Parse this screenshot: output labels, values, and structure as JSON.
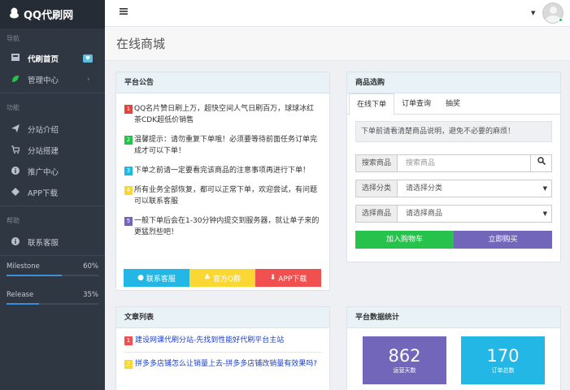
{
  "app": {
    "brand": "QQ代刷网"
  },
  "sidebar": {
    "section_nav": "导航",
    "home": "代刷首页",
    "home_badge": "♥",
    "admin": "管理中心",
    "section_func": "功能",
    "func": [
      "分站介绍",
      "分站搭建",
      "推广中心",
      "APP下载"
    ],
    "section_help": "帮助",
    "service": "联系客服",
    "progress": [
      {
        "label": "Milestone",
        "value": "60%",
        "fraction": 0.6
      },
      {
        "label": "Release",
        "value": "35%",
        "fraction": 0.35
      }
    ]
  },
  "page": {
    "title": "在线商城"
  },
  "notice": {
    "title": "平台公告",
    "items": [
      {
        "num": "1",
        "text": "QQ名片赞日刷上万，超快空间人气日刷百万，球球冰红茶CDK超低价销售",
        "color": "#e0463f"
      },
      {
        "num": "2",
        "text": "温馨提示：请勿重复下单哦！必须要等待前面任务订单完成才可以下单！",
        "color": "#27c24c"
      },
      {
        "num": "3",
        "text": "下单之前请一定要看完该商品的注意事项再进行下单！",
        "color": "#23b7e5"
      },
      {
        "num": "4",
        "text": "所有业务全部恢复，都可以正常下单，欢迎尝试，有问题可以联系客服",
        "color": "#fad733"
      },
      {
        "num": "5",
        "text": "一般下单后会在1-30分钟内提交到服务器，就让单子来的更猛烈些吧！",
        "color": "#7266ba"
      }
    ],
    "buttons": [
      {
        "label": "联系客服",
        "icon": "qq-icon",
        "color": "#23b7e5"
      },
      {
        "label": "官方Q群",
        "icon": "group-icon",
        "color": "#fad733"
      },
      {
        "label": "APP下载",
        "icon": "download-icon",
        "color": "#f05050"
      }
    ]
  },
  "shop": {
    "title": "商品选购",
    "tabs": [
      "在线下单",
      "订单查询",
      "抽奖"
    ],
    "tip": "下单前请看清楚商品说明，避免不必要的麻烦！",
    "search_label": "搜索商品",
    "search_placeholder": "搜索商品",
    "category_label": "选择分类",
    "category_value": "请选择分类",
    "product_label": "选择商品",
    "product_value": "请选择商品",
    "add_cart": "加入购物车",
    "buy_now": "立即购买"
  },
  "articles": {
    "title": "文章列表",
    "items": [
      {
        "num": "1",
        "text": "建设网课代刷分站-先找到性能好代刷平台主站",
        "color": "#f05050"
      },
      {
        "num": "2",
        "text": "拼多多店铺怎么让销量上去-拼多多店铺改销量有效果吗?",
        "color": "#fad733"
      }
    ]
  },
  "stats": {
    "title": "平台数据统计",
    "cards": [
      {
        "value": "862",
        "label": "运营天数",
        "color": "#7266ba"
      },
      {
        "value": "170",
        "label": "订单总数",
        "color": "#23b7e5"
      }
    ]
  }
}
